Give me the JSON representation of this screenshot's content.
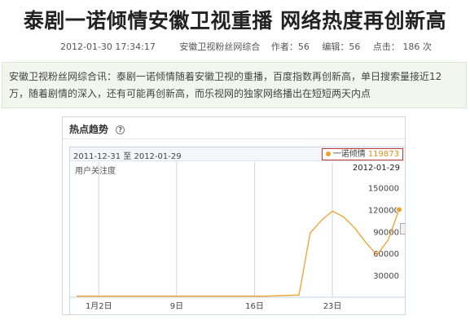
{
  "article": {
    "title": "泰剧一诺倾情安徽卫视重播 网络热度再创新高",
    "date": "2012-01-30 17:34:17",
    "source": "安徽卫视粉丝网综合",
    "author": "作者：56",
    "editor": "编辑：56",
    "clicks": "点击： 186 次",
    "summary": "安徽卫视粉丝网综合讯：泰剧一诺倾情随着安徽卫视的重播，百度指数再创新高，单日搜索量接近12万，随着剧情的深入，还有可能再创新高，而乐视网的独家网络播出在短短两天内点"
  },
  "trend": {
    "header_title": "热点趋势",
    "help_icon_text": "?",
    "range_label": "2011-12-31 至 2012-01-29",
    "legend_name": "一诺倾情",
    "legend_value": "119873",
    "y_label": "用户关注度",
    "tooltip_date": "2012-01-29",
    "colors": {
      "line": "#f0a030",
      "grid": "#c9d6e6"
    }
  },
  "chart_data": {
    "type": "line",
    "title": "",
    "xlabel": "",
    "ylabel": "用户关注度",
    "x_tick_labels": [
      "1月2日",
      "9日",
      "16日",
      "23日"
    ],
    "y_tick_labels": [
      "30000",
      "60000",
      "90000",
      "120000",
      "150000"
    ],
    "ylim": [
      0,
      165000
    ],
    "grid": true,
    "legend_position": "top-right",
    "x": [
      "2011-12-31",
      "2012-01-01",
      "2012-01-02",
      "2012-01-03",
      "2012-01-04",
      "2012-01-05",
      "2012-01-06",
      "2012-01-07",
      "2012-01-08",
      "2012-01-09",
      "2012-01-10",
      "2012-01-11",
      "2012-01-12",
      "2012-01-13",
      "2012-01-14",
      "2012-01-15",
      "2012-01-16",
      "2012-01-17",
      "2012-01-18",
      "2012-01-19",
      "2012-01-20",
      "2012-01-21",
      "2012-01-22",
      "2012-01-23",
      "2012-01-24",
      "2012-01-25",
      "2012-01-26",
      "2012-01-27",
      "2012-01-28",
      "2012-01-29"
    ],
    "series": [
      {
        "name": "一诺倾情",
        "values": [
          1500,
          1500,
          1500,
          1500,
          1500,
          1500,
          1500,
          1500,
          1500,
          1500,
          1500,
          1500,
          1500,
          1500,
          1500,
          1500,
          1500,
          1500,
          2000,
          2500,
          3000,
          88000,
          105000,
          118000,
          110000,
          95000,
          75000,
          58000,
          78000,
          119873
        ]
      }
    ]
  }
}
